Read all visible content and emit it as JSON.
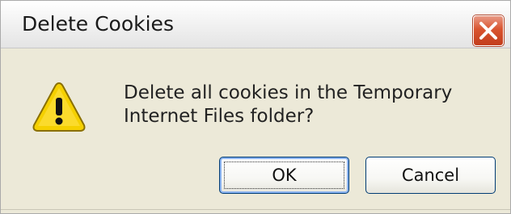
{
  "dialog": {
    "title": "Delete Cookies",
    "message_line1": "Delete all cookies in the Temporary",
    "message_line2": "Internet Files folder?",
    "icon": "warning-icon",
    "close_icon": "close-icon"
  },
  "buttons": {
    "ok_label": "OK",
    "cancel_label": "Cancel"
  },
  "colors": {
    "close_button": "#d9542f",
    "warning_yellow": "#f5d000",
    "button_border": "#003c74"
  }
}
